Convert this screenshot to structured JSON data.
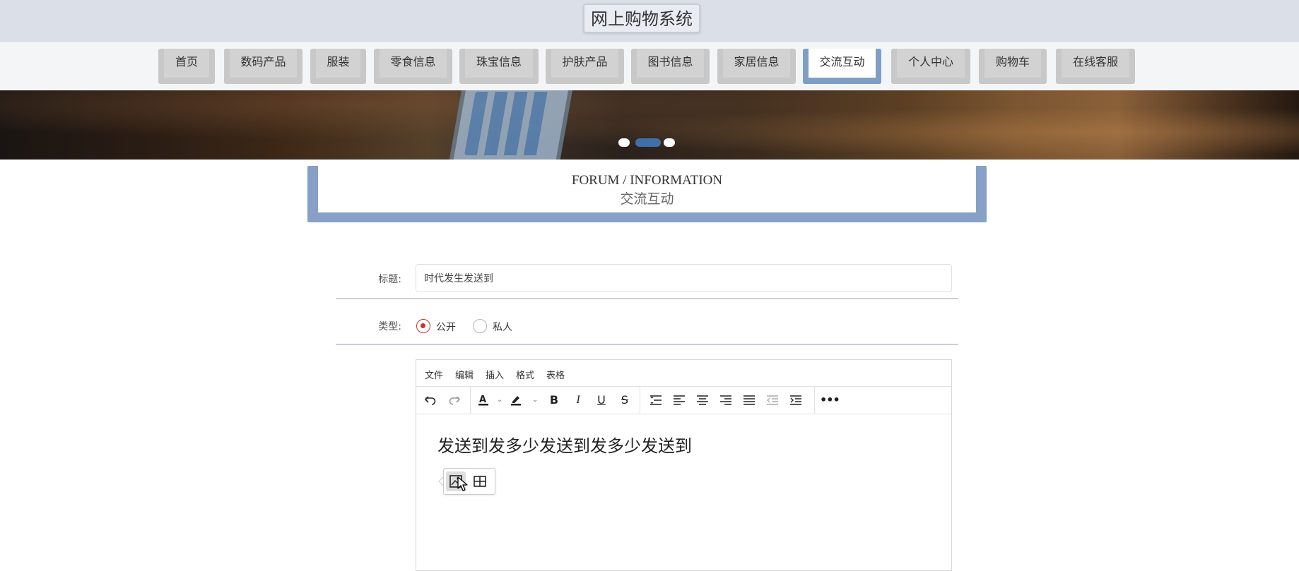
{
  "app": {
    "title": "网上购物系统"
  },
  "nav": {
    "items": [
      {
        "label": "首页"
      },
      {
        "label": "数码产品"
      },
      {
        "label": "服装"
      },
      {
        "label": "零食信息"
      },
      {
        "label": "珠宝信息"
      },
      {
        "label": "护肤产品"
      },
      {
        "label": "图书信息"
      },
      {
        "label": "家居信息"
      },
      {
        "label": "交流互动",
        "active": true
      },
      {
        "label": "个人中心"
      },
      {
        "label": "购物车"
      },
      {
        "label": "在线客服"
      }
    ]
  },
  "banner": {
    "slide_count": 3,
    "active_slide": 2
  },
  "section": {
    "en_title": "FORUM / INFORMATION",
    "cn_title": "交流互动"
  },
  "form": {
    "title_label": "标题:",
    "title_value": "时代发生发送到",
    "type_label": "类型:",
    "type_options": [
      {
        "label": "公开",
        "checked": true
      },
      {
        "label": "私人",
        "checked": false
      }
    ]
  },
  "editor": {
    "menu": [
      "文件",
      "编辑",
      "插入",
      "格式",
      "表格"
    ],
    "toolbar": [
      "undo-icon",
      "redo-icon",
      "text-color-icon",
      "highlight-color-icon",
      "bold-icon",
      "italic-icon",
      "underline-icon",
      "strikethrough-icon",
      "line-height-icon",
      "align-left-icon",
      "align-center-icon",
      "align-right-icon",
      "align-justify-icon",
      "outdent-icon",
      "indent-icon",
      "more-icon"
    ],
    "content": "发送到发多少发送到发多少发送到",
    "quickbar": [
      "image-icon",
      "table-icon"
    ]
  },
  "colors": {
    "header_bg": "#dadfe8",
    "nav_active": "#7f9ec5",
    "section_frame": "#86a0c8",
    "radio_checked": "#d0302a",
    "banner_dot_active": "#3f6fa8"
  }
}
